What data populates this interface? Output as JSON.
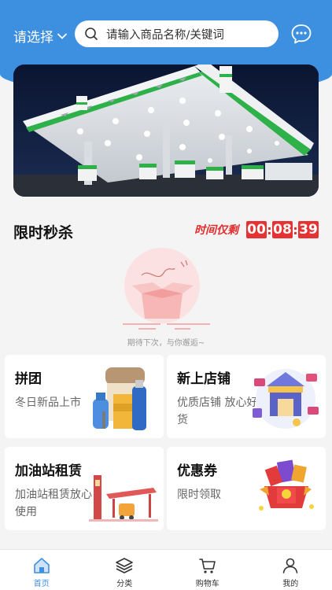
{
  "header": {
    "city_label": "请选择",
    "search_placeholder": "请输入商品名称/关键词"
  },
  "flash_sale": {
    "title": "限时秒杀",
    "countdown_label": "时间仅剩",
    "hours": "00",
    "minutes": "08",
    "seconds": "39",
    "empty_text": "期待下次，与你邂逅~"
  },
  "cards": [
    {
      "title": "拼团",
      "subtitle": "冬日新品上市"
    },
    {
      "title": "新上店铺",
      "subtitle": "优质店铺 放心好货"
    },
    {
      "title": "加油站租赁",
      "subtitle": "加油站租赁放心使用"
    },
    {
      "title": "优惠券",
      "subtitle": "限时领取"
    }
  ],
  "tabbar": [
    {
      "label": "首页",
      "icon": "home-icon",
      "active": true
    },
    {
      "label": "分类",
      "icon": "layers-icon"
    },
    {
      "label": "购物车",
      "icon": "cart-icon"
    },
    {
      "label": "我的",
      "icon": "user-icon"
    }
  ],
  "colors": {
    "brand": "#3d8fe0",
    "countdown": "#e63232",
    "background": "#f4f4f4"
  }
}
